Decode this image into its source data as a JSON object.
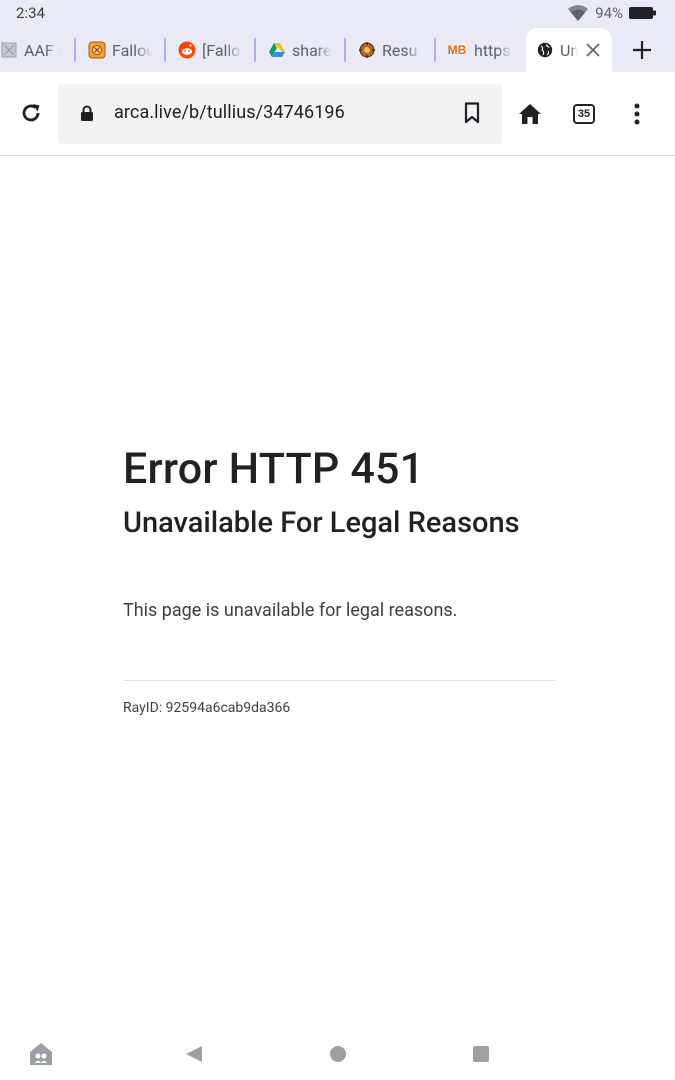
{
  "status_bar": {
    "time": "2:34",
    "battery_percent": "94%"
  },
  "tabs": [
    {
      "title": "AAF U",
      "icon": "aaf-favicon-icon"
    },
    {
      "title": "Fallou",
      "icon": "fallout-favicon-icon"
    },
    {
      "title": "[Fallo",
      "icon": "reddit-icon"
    },
    {
      "title": "share",
      "icon": "google-drive-icon"
    },
    {
      "title": "Resu",
      "icon": "site-favicon-icon"
    },
    {
      "title": "https",
      "icon": "mb-favicon-icon",
      "icon_text": "MB"
    },
    {
      "title": "Un",
      "icon": "globe-icon",
      "active": true
    }
  ],
  "toolbar": {
    "url": "arca.live/b/tullius/34746196",
    "tab_count": "35"
  },
  "page": {
    "title": "Error HTTP 451",
    "subtitle": "Unavailable For Legal Reasons",
    "description": "This page is unavailable for legal reasons.",
    "ray_id": "RayID: 92594a6cab9da366"
  },
  "colors": {
    "tab_strip": "#e8eaf6",
    "omnibox": "#f1f3f4",
    "text": "#202124"
  }
}
